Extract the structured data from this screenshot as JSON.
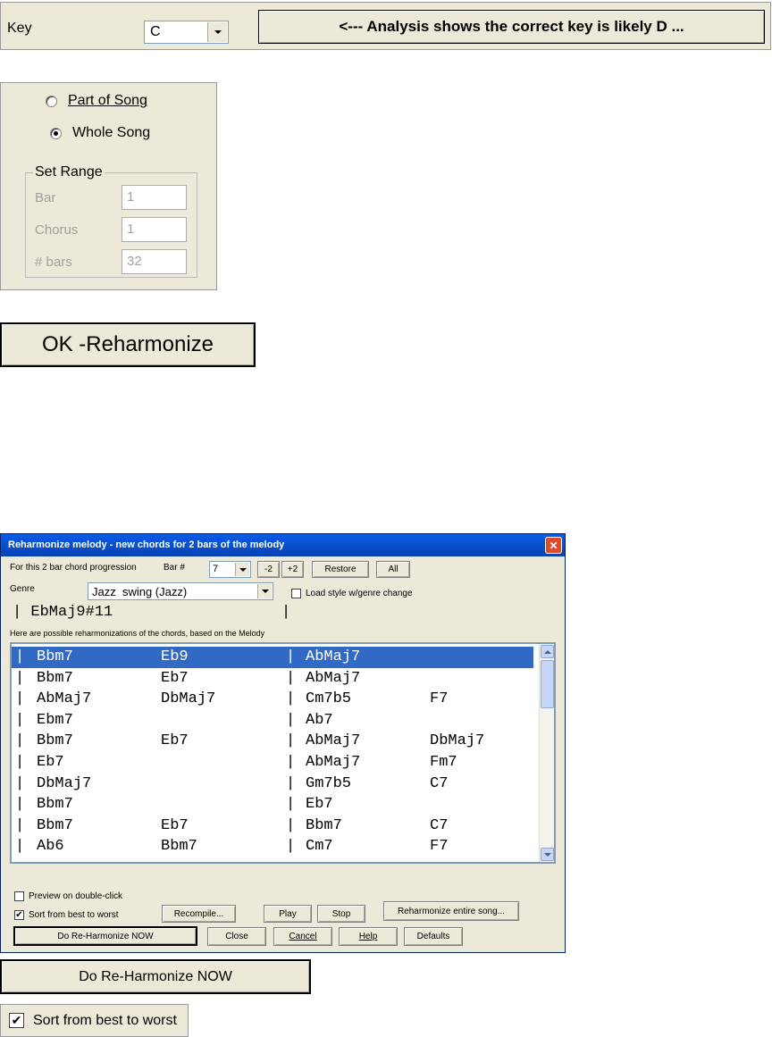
{
  "key_panel": {
    "label": "Key",
    "value": "C",
    "analysis_button": "<--- Analysis shows the correct key is likely D  ..."
  },
  "range_panel": {
    "part_of_song": "Part of Song",
    "whole_song": "Whole Song",
    "selected": "whole_song",
    "set_range_label": "Set Range",
    "bar_label": "Bar",
    "bar_value": "1",
    "chorus_label": "Chorus",
    "chorus_value": "1",
    "bars_label": "# bars",
    "bars_value": "32"
  },
  "ok_button": {
    "label": "OK -Reharmonize"
  },
  "dialog": {
    "title": "Reharmonize melody - new chords for 2 bars of the melody",
    "progression_label": "For this 2 bar chord progression",
    "bar_label": "Bar #",
    "bar_value": "7",
    "minus2": "-2",
    "plus2": "+2",
    "restore": "Restore",
    "all": "All",
    "genre_label": "Genre",
    "genre_value": "Jazz  swing (Jazz)",
    "load_style": "Load style w/genre change",
    "original_chords": "| EbMaj9#11",
    "original_bar_end": "|",
    "possible_label": "Here are possible reharmonizations of the chords, based on the Melody",
    "rows": [
      {
        "c1": "Bbm7",
        "c2": "Eb9",
        "c3": "AbMaj7",
        "c4": ""
      },
      {
        "c1": "Bbm7",
        "c2": "Eb7",
        "c3": "AbMaj7",
        "c4": ""
      },
      {
        "c1": "AbMaj7",
        "c2": "DbMaj7",
        "c3": "Cm7b5",
        "c4": "F7"
      },
      {
        "c1": "Ebm7",
        "c2": "",
        "c3": "Ab7",
        "c4": ""
      },
      {
        "c1": "Bbm7",
        "c2": "Eb7",
        "c3": "AbMaj7",
        "c4": "DbMaj7"
      },
      {
        "c1": "Eb7",
        "c2": "",
        "c3": "AbMaj7",
        "c4": "Fm7"
      },
      {
        "c1": "DbMaj7",
        "c2": "",
        "c3": "Gm7b5",
        "c4": "C7"
      },
      {
        "c1": "Bbm7",
        "c2": "",
        "c3": "Eb7",
        "c4": ""
      },
      {
        "c1": "Bbm7",
        "c2": "Eb7",
        "c3": "Bbm7",
        "c4": "C7"
      },
      {
        "c1": "Ab6",
        "c2": "Bbm7",
        "c3": "Cm7",
        "c4": "F7"
      }
    ],
    "bar_sep": "|",
    "preview": "Preview on double-click",
    "sort": "Sort from best to worst",
    "recompile": "Recompile...",
    "play": "Play",
    "stop": "Stop",
    "reharm_entire": "Reharmonize entire song...",
    "do_reharm": "Do Re-Harmonize NOW",
    "close": "Close",
    "cancel": "Cancel",
    "help": "Help",
    "defaults": "Defaults",
    "close_glyph": "✕"
  },
  "zoom_do_reharm": {
    "label": "Do Re-Harmonize NOW"
  },
  "zoom_sort": {
    "label": "Sort from best to worst",
    "check_glyph": "✔"
  },
  "colors": {
    "xp_title": "#0a246a",
    "selection": "#316ac5",
    "panel": "#ece9d8"
  }
}
